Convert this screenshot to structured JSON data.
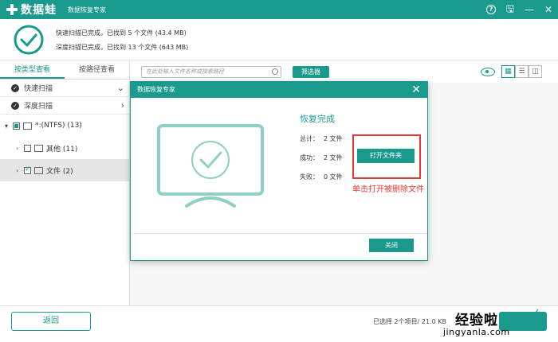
{
  "app": {
    "logo_text": "数据蛙",
    "subtitle": "数据恢复专家"
  },
  "window_controls": {
    "help": "?",
    "save": "🖫",
    "minimize": "—",
    "close": "✕"
  },
  "summary": {
    "quick_scan": "快速扫描已完成，已找到 5 个文件 (43.4 MB)",
    "deep_scan": "深度扫描已完成，已找到 13 个文件 (643 MB)"
  },
  "sidebar": {
    "tabs": [
      "按类型查看",
      "按路径查看"
    ],
    "scan_items": [
      "快速扫描",
      "深度扫描"
    ],
    "drive": "*:(NTFS) (13)",
    "folders": [
      {
        "label": "其他 (11)"
      },
      {
        "label": "文件 (2)"
      }
    ]
  },
  "toolbar": {
    "search_placeholder": "在此处输入文件名称或搜索路径",
    "filter_label": "筛选器"
  },
  "bottom": {
    "back_label": "返回",
    "status": "已选择 2个项目/ 21.0 KB",
    "watermark_big": "经验啦",
    "watermark_check": "✓",
    "watermark_small": "jingyanla.com"
  },
  "dialog": {
    "title": "数据恢复专家",
    "close_icon": "✕",
    "heading": "恢复完成",
    "total_label": "总计：",
    "total_value": "2 文件",
    "success_label": "成功：",
    "success_value": "2 文件",
    "fail_label": "失败：",
    "fail_value": "0 文件",
    "open_folder_label": "打开文件夹",
    "annotation": "单击打开被删除文件",
    "close_label": "关闭"
  },
  "colors": {
    "accent": "#1a9a8c",
    "annotation": "#e53935"
  }
}
